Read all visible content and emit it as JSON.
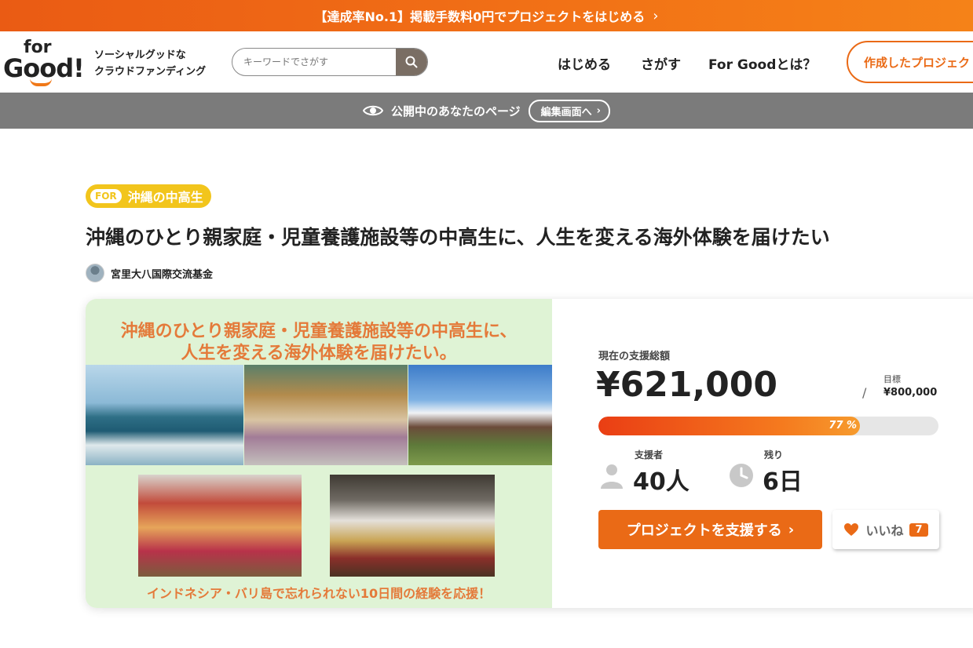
{
  "promo": {
    "text": "【達成率No.1】掲載手数料0円でプロジェクトをはじめる",
    "chevron": "›"
  },
  "header": {
    "logo_for": "for",
    "logo_good": "Good!",
    "tagline_line1": "ソーシャルグッドな",
    "tagline_line2": "クラウドファンディング",
    "search_placeholder": "キーワードでさがす",
    "nav": [
      "はじめる",
      "さがす",
      "For Goodとは？"
    ],
    "create_button": "作成したプロジェクト"
  },
  "public_bar": {
    "text": "公開中のあなたのページ",
    "edit_button": "編集画面へ"
  },
  "project": {
    "for_tag": "FOR",
    "for_target": "沖縄の中高生",
    "title": "沖縄のひとり親家庭・児童養護施設等の中高生に、人生を変える海外体験を届けたい",
    "owner": "宮里大八国際交流基金",
    "hero_line1": "沖縄のひとり親家庭・児童養護施設等の中高生に、",
    "hero_line2": "人生を変える海外体験を届けたい。",
    "hero_footer": "インドネシア・バリ島で忘れられない10日間の経験を応援！"
  },
  "funding": {
    "label_total": "現在の支援総額",
    "amount": "¥621,000",
    "slash": "/",
    "goal_label": "目標",
    "goal": "¥800,000",
    "progress_pct": 77,
    "progress_label": "77 %",
    "supporters_label": "支援者",
    "supporters": "40人",
    "remaining_label": "残り",
    "remaining": "6日",
    "support_button": "プロジェクトを支援する",
    "like_label": "いいね",
    "like_count": "7"
  },
  "colors": {
    "accent": "#ea6a16",
    "badge": "#f2c51c",
    "hero_bg": "#dff3d5",
    "hero_text": "#e47a3a",
    "bar_gray": "#7b7b7b"
  }
}
